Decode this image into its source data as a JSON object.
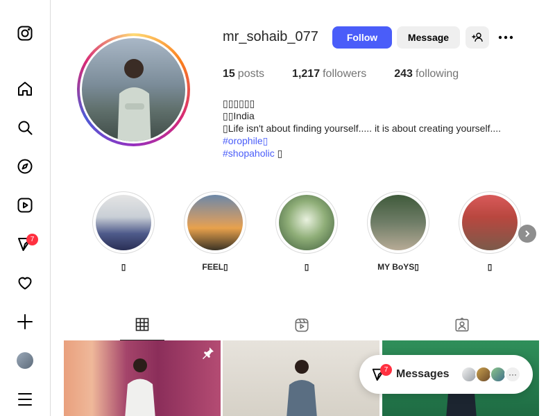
{
  "sidebar": {
    "items": [
      {
        "name": "instagram-icon"
      },
      {
        "name": "home-icon"
      },
      {
        "name": "search-icon"
      },
      {
        "name": "explore-icon"
      },
      {
        "name": "reels-icon"
      },
      {
        "name": "messages-icon",
        "badge": "7"
      },
      {
        "name": "notifications-icon"
      },
      {
        "name": "create-icon"
      },
      {
        "name": "profile-avatar"
      },
      {
        "name": "menu-icon"
      }
    ]
  },
  "profile": {
    "username": "mr_sohaib_077",
    "follow_label": "Follow",
    "message_label": "Message",
    "stats": {
      "posts_count": "15",
      "posts_label": "posts",
      "followers_count": "1,217",
      "followers_label": "followers",
      "following_count": "243",
      "following_label": "following"
    },
    "bio": {
      "line1": "▯▯▯▯▯▯",
      "line2": "▯▯India",
      "line3": "▯Life isn't about finding yourself..... it is about creating yourself....",
      "line4_link": "#orophile▯",
      "line5_link": "#shopaholic",
      "line5_after": " ▯"
    }
  },
  "highlights": [
    {
      "label": "▯"
    },
    {
      "label": "FEEL▯"
    },
    {
      "label": "▯"
    },
    {
      "label": "MY BoYS▯"
    },
    {
      "label": "▯"
    }
  ],
  "tabs": [
    {
      "name": "posts-tab-icon",
      "active": true
    },
    {
      "name": "reels-tab-icon",
      "active": false
    },
    {
      "name": "tagged-tab-icon",
      "active": false
    }
  ],
  "messages_pill": {
    "label": "Messages",
    "badge": "7",
    "more": "···"
  }
}
